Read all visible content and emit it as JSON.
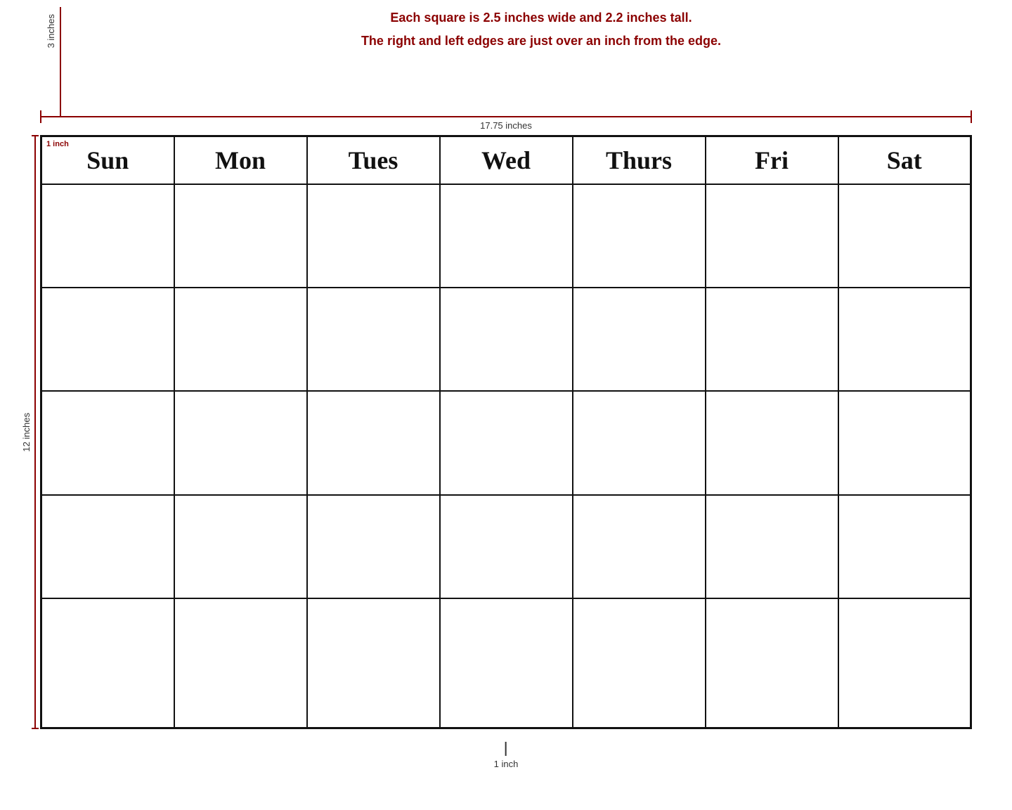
{
  "annotations": {
    "line1": "Each square is 2.5 inches wide and 2.2 inches tall.",
    "line2": "The right and left edges are just over an inch from the edge.",
    "width_label": "17.75 inches",
    "height_label": "12 inches",
    "top_height_label": "3 inches",
    "bottom_inch_label": "1 inch",
    "top_left_inch_label": "1 inch"
  },
  "days": {
    "headers": [
      "Sun",
      "Mon",
      "Tues",
      "Wed",
      "Thurs",
      "Fri",
      "Sat"
    ]
  },
  "grid": {
    "rows": 5,
    "cols": 7
  }
}
